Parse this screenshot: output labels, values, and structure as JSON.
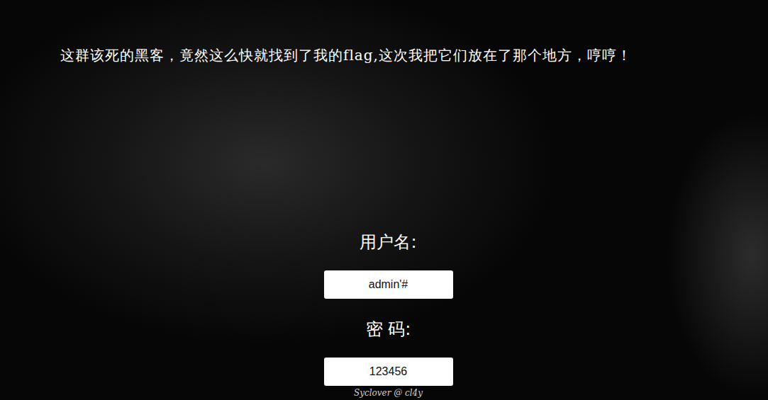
{
  "title": "这群该死的黑客，竟然这么快就找到了我的flag,这次我把它们放在了那个地方，哼哼！",
  "form": {
    "fields": [
      {
        "label": "用户名:",
        "value": "admin'#"
      },
      {
        "label": "密 码:",
        "value": "123456"
      }
    ]
  },
  "footer": "Syclover @ cl4y"
}
